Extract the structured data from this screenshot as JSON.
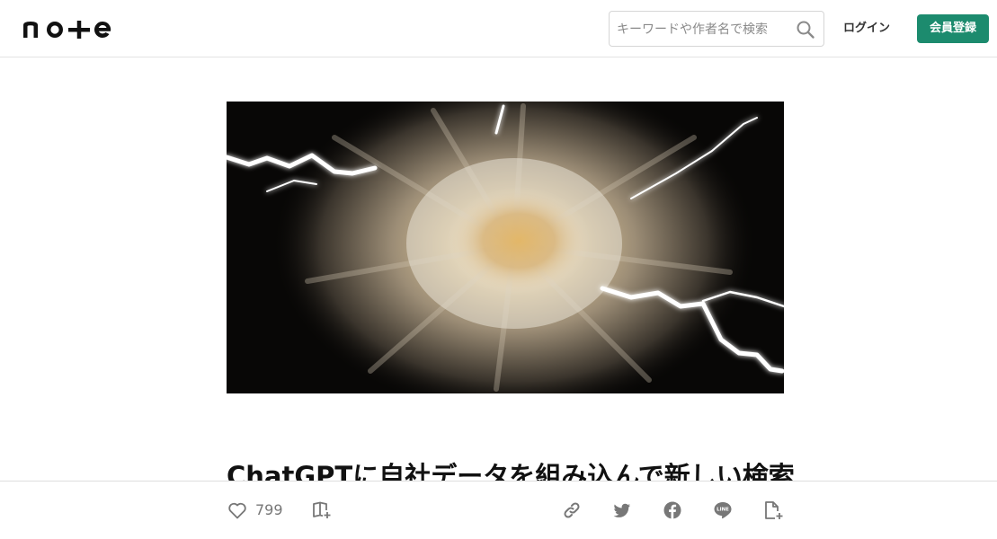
{
  "header": {
    "logo_text": "note",
    "search": {
      "placeholder": "キーワードや作者名で検索",
      "value": "",
      "icon": "search-icon"
    },
    "login_label": "ログイン",
    "signup_label": "会員登録",
    "accent_color": "#1c8b6e"
  },
  "article": {
    "title": "ChatGPTに自社データを組み込んで新しい検索"
  },
  "actions": {
    "like_count": "799",
    "icons": [
      "heart-icon",
      "magazine-add-icon",
      "link-icon",
      "twitter-icon",
      "facebook-icon",
      "line-icon",
      "embed-icon"
    ]
  }
}
